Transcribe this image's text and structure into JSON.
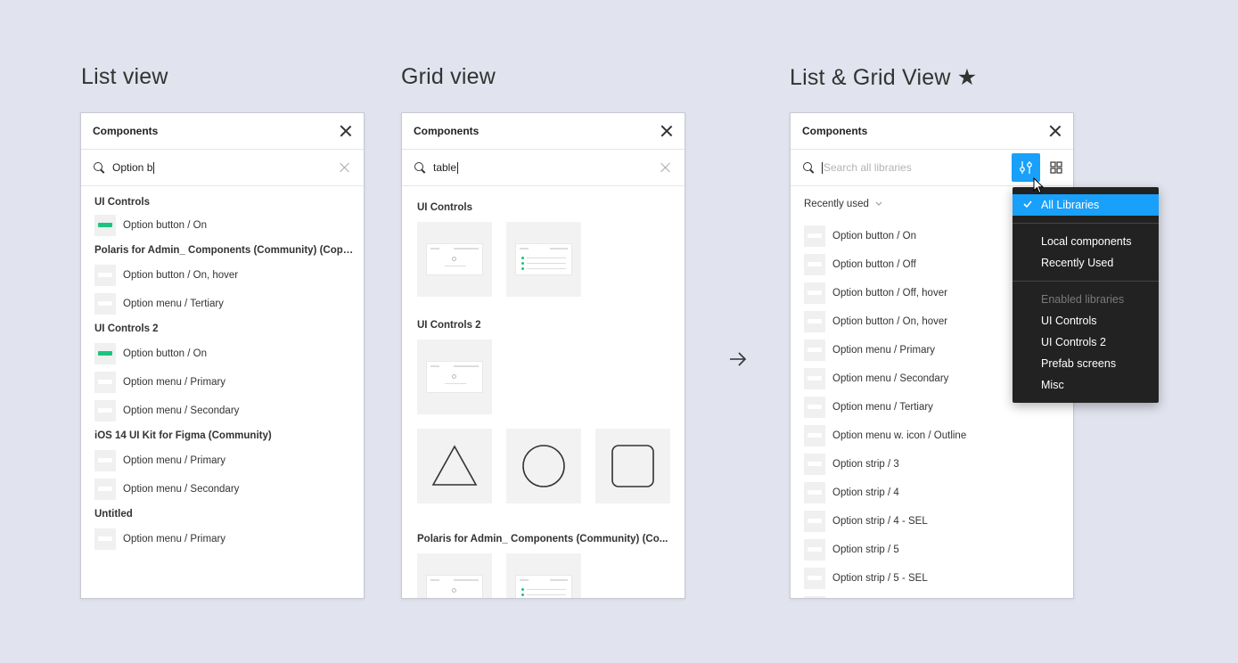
{
  "headings": {
    "list": "List view",
    "grid": "Grid view",
    "listgrid": "List & Grid View ★"
  },
  "list_panel": {
    "title": "Components",
    "search_value": "Option b",
    "sections": [
      {
        "title": "UI Controls",
        "items": [
          {
            "label": "Option button / On",
            "thumb": "green"
          }
        ]
      },
      {
        "title": "Polaris for Admin_ Components (Community) (Copy) ...",
        "items": [
          {
            "label": "Option button / On, hover",
            "thumb": "white"
          },
          {
            "label": "Option menu / Tertiary",
            "thumb": "white"
          }
        ]
      },
      {
        "title": "UI Controls 2",
        "items": [
          {
            "label": "Option button / On",
            "thumb": "green"
          },
          {
            "label": "Option menu / Primary",
            "thumb": "white"
          },
          {
            "label": "Option menu / Secondary",
            "thumb": "white"
          }
        ]
      },
      {
        "title": "iOS 14 UI Kit for Figma (Community)",
        "items": [
          {
            "label": "Option menu / Primary",
            "thumb": "white"
          },
          {
            "label": "Option menu / Secondary",
            "thumb": "white"
          }
        ]
      },
      {
        "title": "Untitled",
        "items": [
          {
            "label": "Option menu / Primary",
            "thumb": "white"
          }
        ]
      }
    ]
  },
  "grid_panel": {
    "title": "Components",
    "search_value": "table",
    "sections": [
      "UI Controls",
      "UI Controls 2",
      "Polaris for Admin_ Components (Community) (Co..."
    ],
    "shape_tiles": [
      "triangle-icon",
      "circle-icon",
      "rounded-square-icon"
    ]
  },
  "listgrid_panel": {
    "title": "Components",
    "search_placeholder": "Search all libraries",
    "filter_label": "Recently used",
    "items": [
      "Option button / On",
      "Option button / Off",
      "Option button / Off, hover",
      "Option button / On, hover",
      "Option menu / Primary",
      "Option menu / Secondary",
      "Option menu / Tertiary",
      "Option menu w. icon / Outline",
      "Option strip / 3",
      "Option strip / 4",
      "Option strip / 4 - SEL",
      "Option strip / 5",
      "Option strip / 5 - SEL"
    ]
  },
  "dropdown": {
    "selected": "All Libraries",
    "group1": [
      "Local components",
      "Recently Used"
    ],
    "group2_header": "Enabled libraries",
    "group2": [
      "UI Controls",
      "UI Controls 2",
      "Prefab screens",
      "Misc"
    ]
  },
  "colors": {
    "background": "#e1e3ee",
    "accent": "#18a0fb",
    "green": "#1bc47d",
    "menu_bg": "#222222"
  }
}
